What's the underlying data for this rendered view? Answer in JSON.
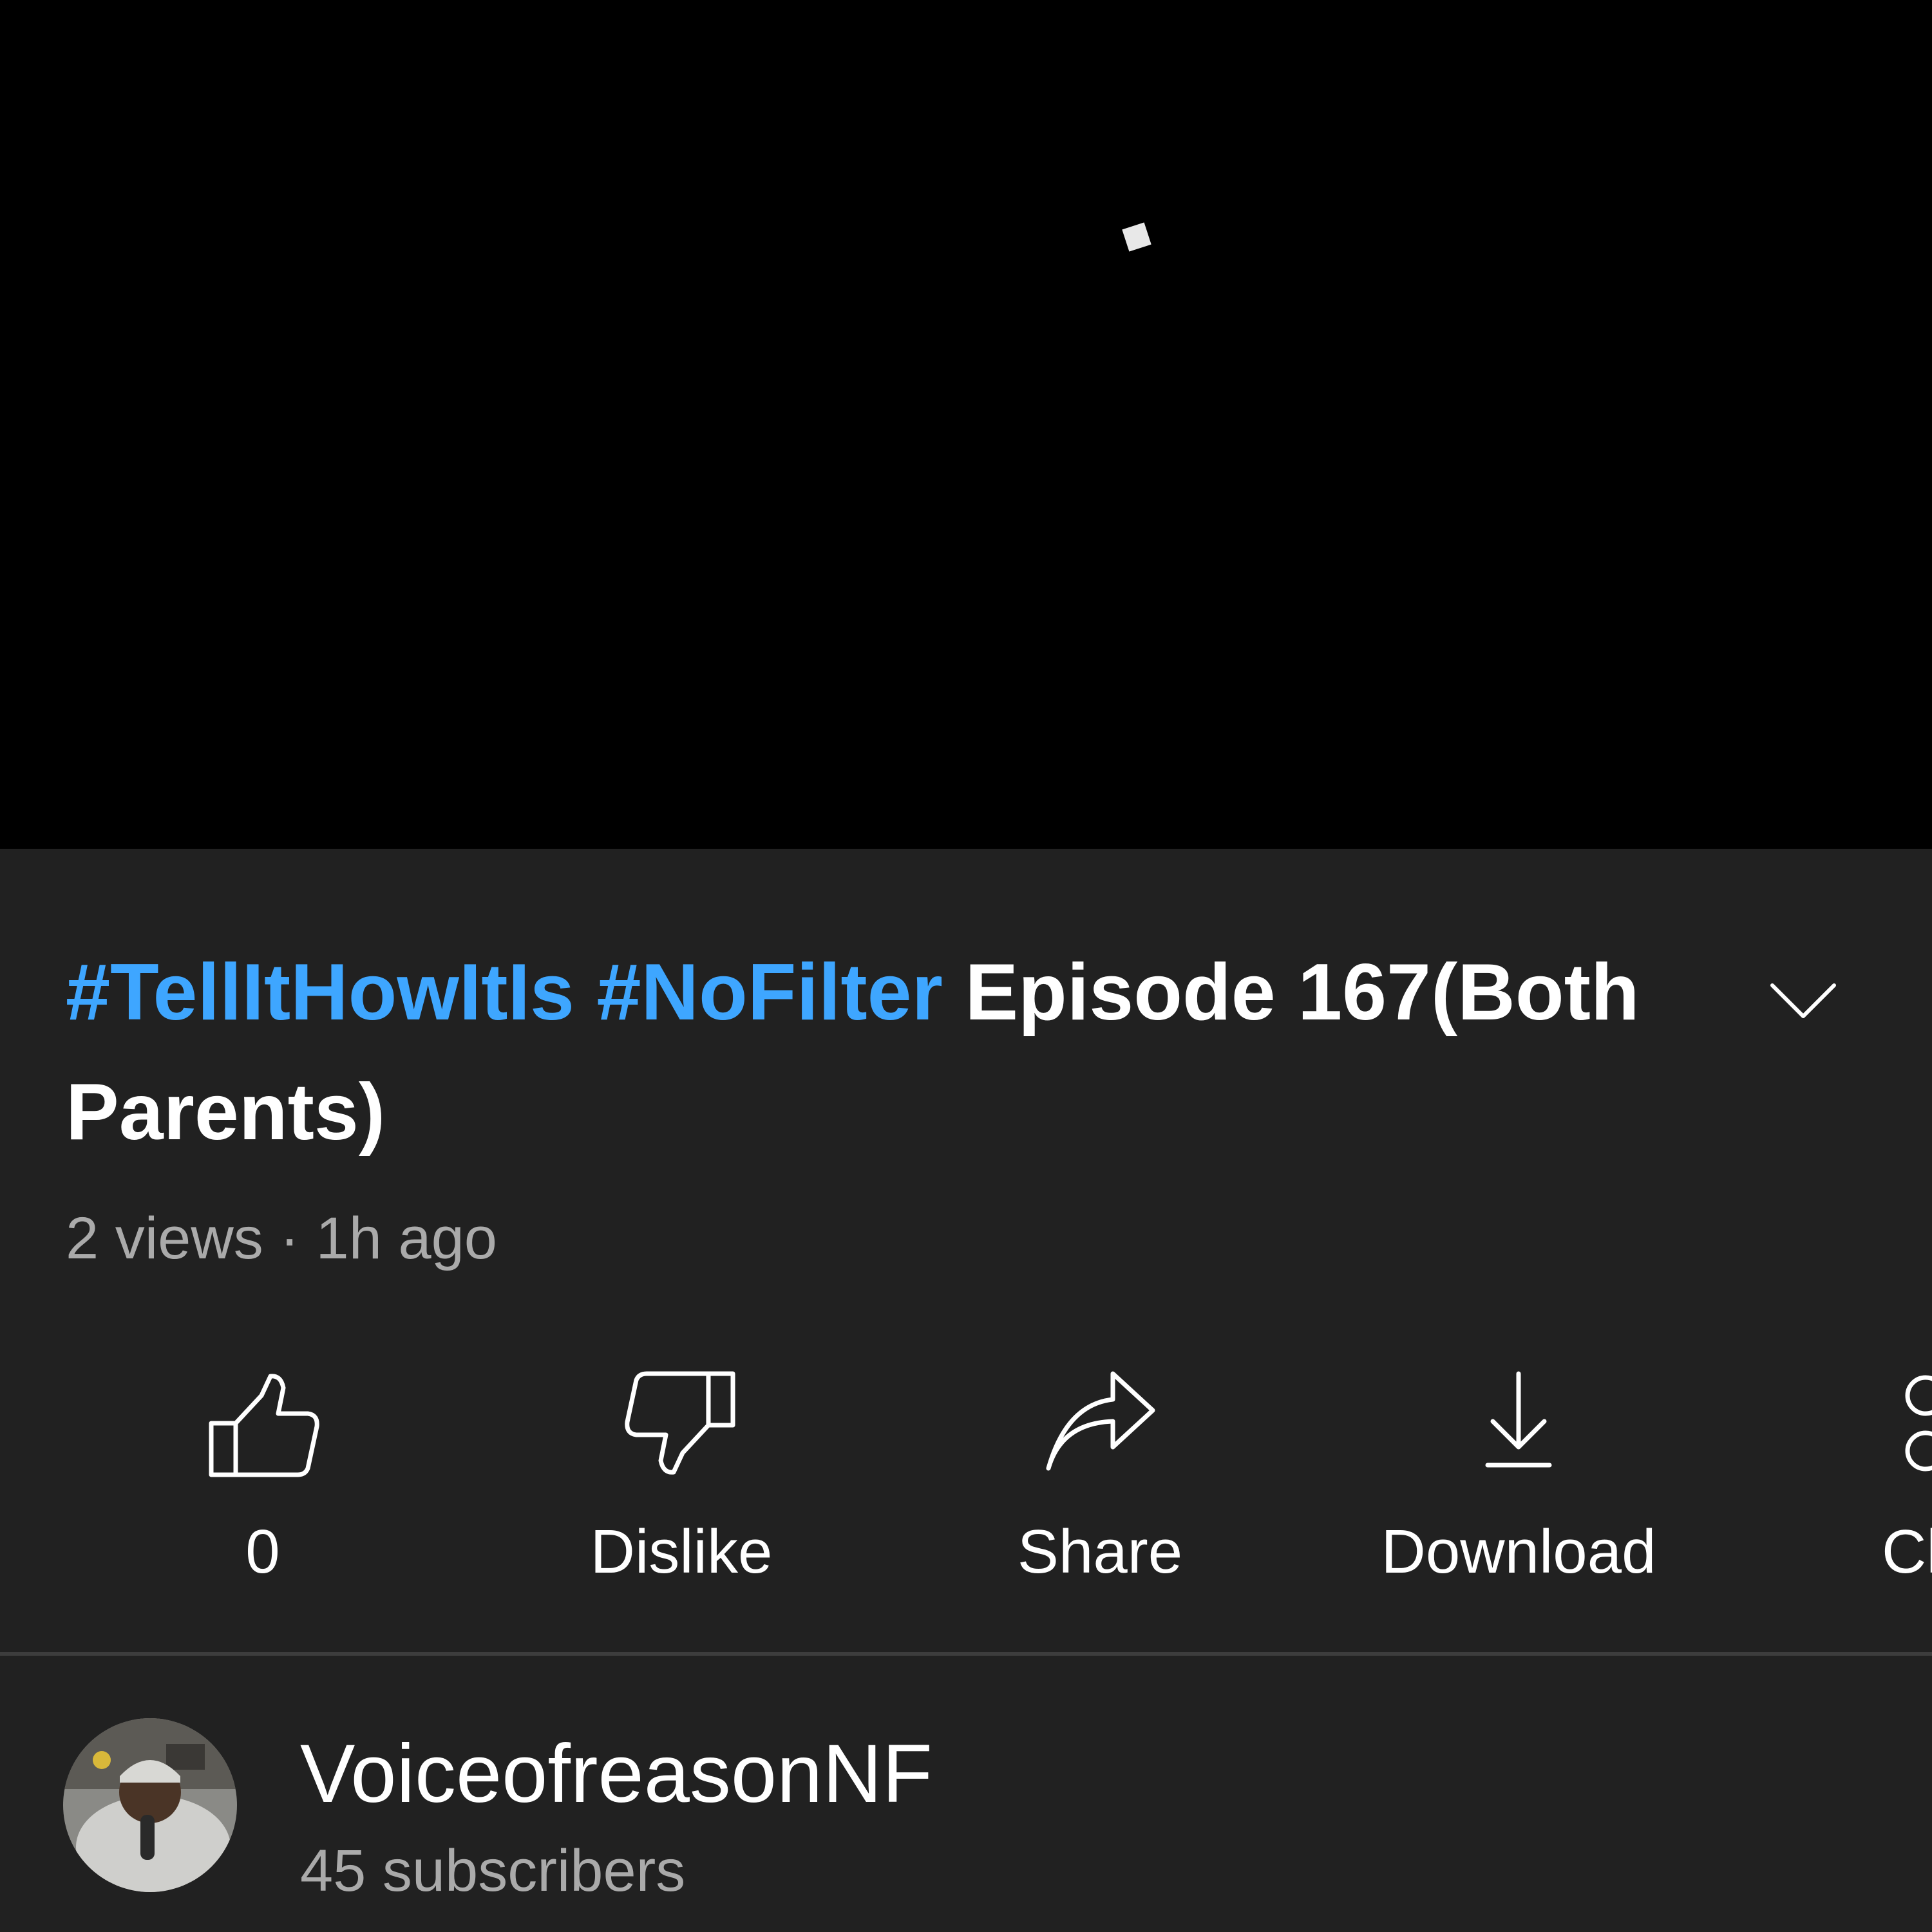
{
  "player": {
    "background": "#000000"
  },
  "video": {
    "title_hashtags": "#TellItHowItIs #NoFilter",
    "title_text": " Episode 167(Both Parents)",
    "views": "2 views",
    "separator": "·",
    "age": "1h ago"
  },
  "actions": [
    {
      "icon": "thumbs-up-icon",
      "label": "0"
    },
    {
      "icon": "thumbs-down-icon",
      "label": "Dislike"
    },
    {
      "icon": "share-arrow-icon",
      "label": "Share"
    },
    {
      "icon": "download-icon",
      "label": "Download"
    },
    {
      "icon": "clip-scissors-icon",
      "label": "Cl"
    }
  ],
  "channel": {
    "name": "VoiceofreasonNF",
    "subscribers": "45 subscribers"
  },
  "colors": {
    "accent_link": "#3ea6ff",
    "background": "#212121",
    "secondary_text": "#aaaaaa"
  }
}
